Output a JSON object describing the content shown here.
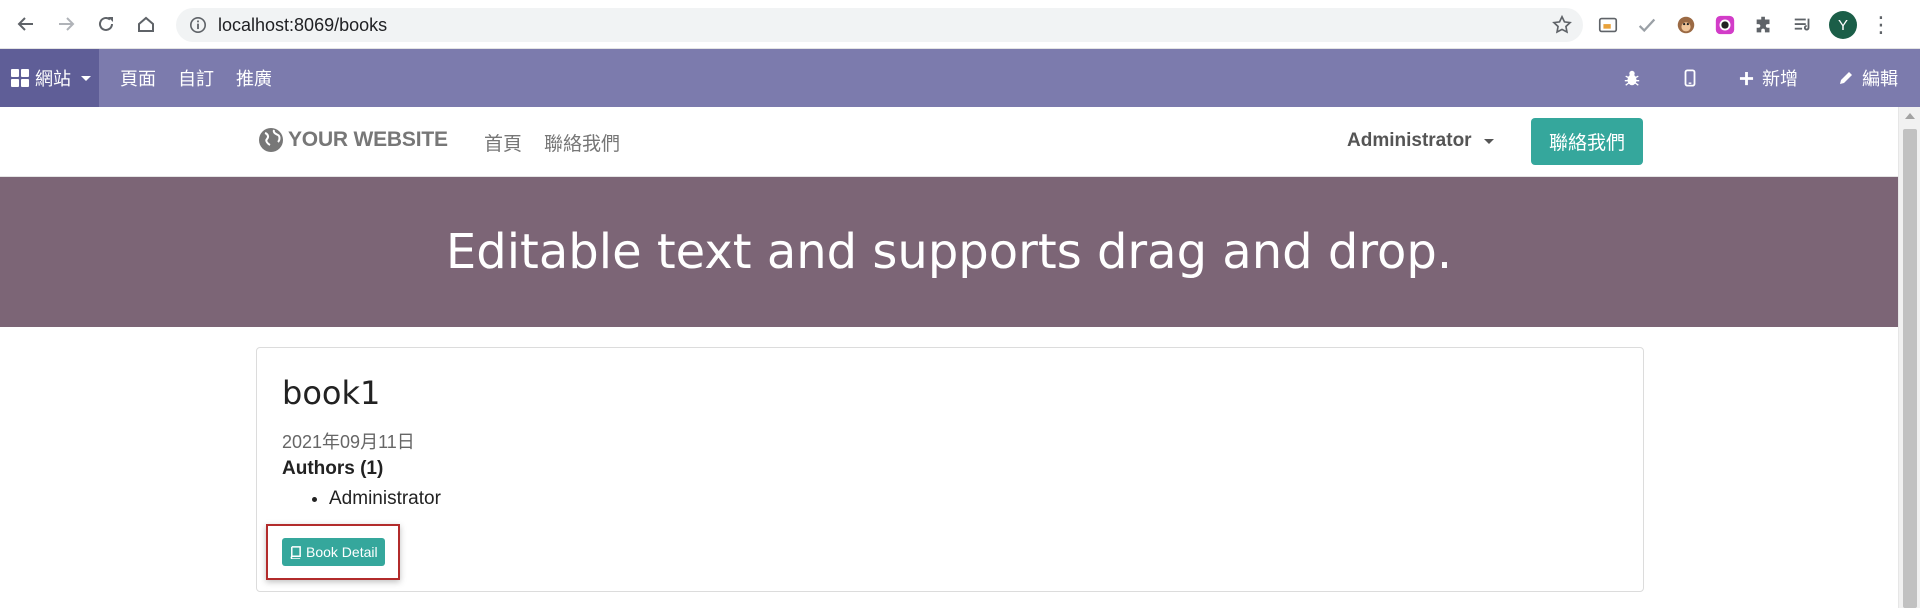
{
  "browser": {
    "url": "localhost:8069/books",
    "avatar_letter": "Y"
  },
  "admin_bar": {
    "apps_label": "網站",
    "menu": [
      "頁面",
      "自訂",
      "推廣"
    ],
    "new_label": "新增",
    "edit_label": "編輯"
  },
  "site": {
    "logo_text": "YOUR WEBSITE",
    "menu": [
      "首頁",
      "聯絡我們"
    ],
    "user_label": "Administrator",
    "cta_label": "聯絡我們",
    "accent_color": "#35a79c",
    "banner_color": "#7c6576"
  },
  "banner": {
    "text": "Editable text and supports drag and drop."
  },
  "book": {
    "title": "book1",
    "date": "2021年09月11日",
    "authors_heading": "Authors (1)",
    "authors": [
      "Administrator"
    ],
    "detail_button": "Book Detail"
  }
}
